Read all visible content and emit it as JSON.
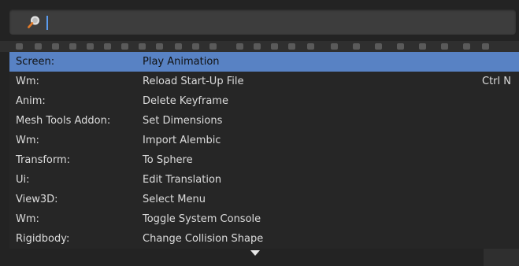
{
  "search": {
    "value": "",
    "placeholder": ""
  },
  "results": [
    {
      "category": "Screen:",
      "operator": "Play Animation",
      "shortcut": "",
      "selected": true
    },
    {
      "category": "Wm:",
      "operator": "Reload Start-Up File",
      "shortcut": "Ctrl N",
      "selected": false
    },
    {
      "category": "Anim:",
      "operator": "Delete Keyframe",
      "shortcut": "",
      "selected": false
    },
    {
      "category": "Mesh Tools Addon:",
      "operator": "Set Dimensions",
      "shortcut": "",
      "selected": false
    },
    {
      "category": "Wm:",
      "operator": "Import Alembic",
      "shortcut": "",
      "selected": false
    },
    {
      "category": "Transform:",
      "operator": "To Sphere",
      "shortcut": "",
      "selected": false
    },
    {
      "category": "Ui:",
      "operator": "Edit Translation",
      "shortcut": "",
      "selected": false
    },
    {
      "category": "View3D:",
      "operator": "Select Menu",
      "shortcut": "",
      "selected": false
    },
    {
      "category": "Wm:",
      "operator": "Toggle System Console",
      "shortcut": "",
      "selected": false
    },
    {
      "category": "Rigidbody:",
      "operator": "Change Collision Shape",
      "shortcut": "",
      "selected": false
    }
  ],
  "icons": {
    "search": "magnifier-icon",
    "scroll_down": "scroll-down-arrow-icon"
  },
  "colors": {
    "selected_row": "#5882c4",
    "cursor": "#5b9cf0",
    "panel_bg": "#262626",
    "search_bg": "#3d3d3d",
    "text": "#dcdcdc"
  }
}
